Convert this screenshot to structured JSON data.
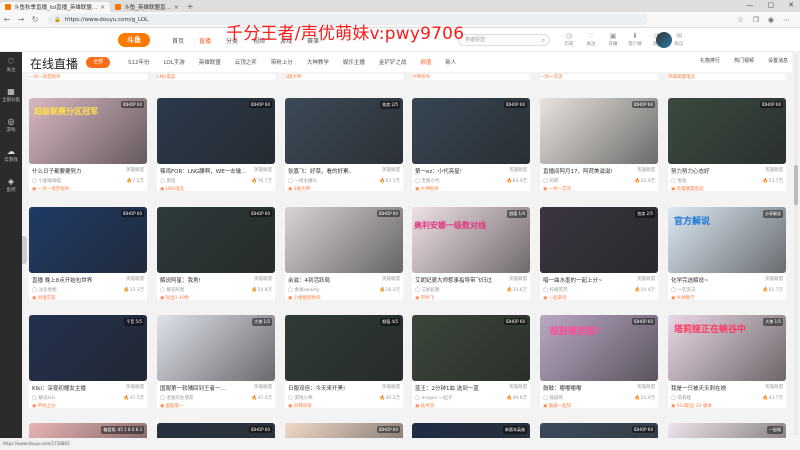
{
  "browser": {
    "tabs": [
      {
        "label": "斗鱼秋季直播_lol直播_英雄联盟..."
      },
      {
        "label": "斗鱼_英雄联盟直..."
      }
    ],
    "url": "https://www.douyu.com/g_LOL"
  },
  "watermark": "千分王者/声优萌妹v:pwy9706",
  "header": {
    "logo": "斗鱼",
    "nav": [
      "首页",
      "直播",
      "分类",
      "视频",
      "游戏",
      "赛事"
    ],
    "search_placeholder": "英雄联盟",
    "icons": [
      {
        "label": "历史",
        "icon": "clock-icon"
      },
      {
        "label": "关注",
        "icon": "heart-icon"
      },
      {
        "label": "开播",
        "icon": "camera-icon"
      },
      {
        "label": "客户端",
        "icon": "download-icon"
      },
      {
        "label": "消息",
        "icon": "bell-icon"
      },
      {
        "label": "私信",
        "icon": "chat-icon"
      }
    ]
  },
  "sidebar": {
    "items": [
      {
        "label": "关注",
        "icon": "heart-icon"
      },
      {
        "label": "全部分类",
        "icon": "grid-icon"
      },
      {
        "label": "游戏",
        "icon": "gamepad-icon"
      },
      {
        "label": "云游戏",
        "icon": "cloud-icon"
      },
      {
        "label": "鱼吧",
        "icon": "fish-icon"
      }
    ]
  },
  "catbar": {
    "page_title": "在线直播",
    "all_label": "全部",
    "categories": [
      "S12年份",
      "LOL手游",
      "英雄联盟",
      "云顶之弈",
      "带粉上分",
      "大神教学",
      "娱乐主播",
      "金铲铲之战",
      "颜值",
      "新人"
    ],
    "right_buttons": [
      "礼物排行",
      "热门视频",
      "设置消息"
    ]
  },
  "cards": [
    {
      "title": "什么日子都要要努力",
      "cat": "英雄联盟",
      "streamer": "小鹿呦呦喵",
      "viewers": "7.5万",
      "tag": "一对一语音指导",
      "badge": "IDHOP 60",
      "bg": "#d8b7c3"
    },
    {
      "title": "辣鸡FOR：LNG腰啊，WE一击输...",
      "cat": "英雄联盟",
      "streamer": "斯坦",
      "viewers": "76.7万",
      "tag": "LNG电竞",
      "badge": "IDHOP 60",
      "bg": "#2b3a4c"
    },
    {
      "title": "张嘉飞：好菜，看的好累。",
      "cat": "英雄联盟",
      "streamer": "一周主播FL",
      "viewers": "63.1万",
      "tag": "3级大神",
      "badge": "拍卖 2/5",
      "bg": "#3c4a58"
    },
    {
      "title": "第一ez：小代亮星!",
      "cat": "英雄联盟",
      "streamer": "无敌小代",
      "viewers": "64.4万",
      "tag": "大神指导",
      "badge": "IDHOP 60",
      "bg": "#374654"
    },
    {
      "title": "直播间阿月17，阿荷美滋滋!",
      "cat": "英雄联盟",
      "streamer": "阿荷",
      "viewers": "42.4万",
      "tag": "一对一交流",
      "badge": "IDHOP 60",
      "bg": "#e8e4e0"
    },
    {
      "title": "努力努力心态好",
      "cat": "英雄联盟",
      "streamer": "兔兔",
      "viewers": "53.7万",
      "tag": "英雄联盟电竞",
      "badge": "IDHOP 60",
      "bg": "#3a4a40"
    },
    {
      "title": "直播 晚上8点开始包世界",
      "cat": "英雄联盟",
      "streamer": "淡化青栖",
      "viewers": "33.3万",
      "tag": "灵魂交友",
      "badge": "IDHOP 60",
      "bg": "#1f3a66"
    },
    {
      "title": "解说阿星：我男!",
      "cat": "英雄联盟",
      "streamer": "解说阿星",
      "viewers": "54.8万",
      "tag": "玩出1-10秒",
      "badge": "IDHOP 60",
      "bg": "#2e3a3a"
    },
    {
      "title": "余滋：4到活跃局",
      "cat": "英雄联盟",
      "streamer": "余滋sweety",
      "viewers": "16.2万",
      "tag": "小姐姐陪你玩",
      "badge": "IDHOP 60",
      "bg": "#d9d3d5"
    },
    {
      "title": "艾妮妃婆大师惹事指导带飞归过",
      "cat": "英雄联盟",
      "streamer": "艾妮妃婆",
      "viewers": "33.6万",
      "tag": "带你飞",
      "badge": "颜值 1/4",
      "bg": "#efe0e8"
    },
    {
      "title": "唱一曲水墨的一起上分~",
      "cat": "英雄联盟",
      "streamer": "柠檬苏苏",
      "viewers": "10.4万",
      "tag": "一起来玩",
      "badge": "拍卖 2/5",
      "bg": "#3a3540"
    },
    {
      "title": "化学完选解说~",
      "cat": "英雄联盟",
      "streamer": "一区黑马",
      "viewers": "61.7万",
      "tag": "大神教学",
      "badge": "分享解说",
      "bg": "#dce8f3"
    },
    {
      "title": "Kiki：深夜初瞳女主播",
      "cat": "英雄联盟",
      "streamer": "解说kiki",
      "viewers": "47.5万",
      "tag": "带你上分",
      "badge": "千音 5/5",
      "bg": "#23314f"
    },
    {
      "title": "国服第一软辅回到王者一...",
      "cat": "英雄联盟",
      "streamer": "老板的女朋友",
      "viewers": "47.4万",
      "tag": "国服第一",
      "badge": "大神 1/5",
      "bg": "#dfe2ea"
    },
    {
      "title": "日服双倍：今天来开黑!",
      "cat": "英雄联盟",
      "streamer": "游戏小神",
      "viewers": "40.2万",
      "tag": "日韩双排",
      "badge": "颜值 4/5",
      "bg": "#2f3b36"
    },
    {
      "title": "蓝王：2分钟1血 选到一蓝",
      "cat": "英雄联盟",
      "streamer": "dragon 一起子",
      "viewers": "49.6万",
      "tag": "技术流",
      "badge": "IDHOP 60",
      "bg": "#3b463a"
    },
    {
      "title": "鼓鼓：嘟嘟嘟嘟",
      "cat": "英雄联盟",
      "streamer": "鼓鼓咚",
      "viewers": "53.4万",
      "tag": "鼓鼓一起玩",
      "badge": "IDHOP 60",
      "bg": "#b9a7c3"
    },
    {
      "title": "我是一只被天天刺在她",
      "cat": "英雄联盟",
      "streamer": "塔莉娅",
      "viewers": "43.7万",
      "tag": "S12职业 13 版本",
      "badge": "大神 1/5",
      "bg": "#e9d8e4"
    }
  ],
  "overlays": [
    {
      "text": "超级联赛分区冠军"
    },
    {
      "text": "奥利安娜一级数对线"
    },
    {
      "text": "官方解说"
    },
    {
      "text": "鼓鼓哪里鼓?"
    },
    {
      "text": "塔莉娅正在峡谷中"
    }
  ],
  "bottom_cards": [
    {
      "bg": "#e9b3b3",
      "text": "偏爱我: 85 1 8 0 8 3"
    },
    {
      "bg": "#25303f",
      "text": "IDHOP 60"
    },
    {
      "bg": "#f0d9c8",
      "text": "IDHOP 60"
    },
    {
      "bg": "#1e2c45",
      "text": "新版本英雄"
    },
    {
      "bg": "#3a4a5b",
      "text": "IDHOP 60"
    },
    {
      "bg": "#eee3ea",
      "text": "一起唱"
    }
  ],
  "status": "https://www.douyu.com/1718863"
}
